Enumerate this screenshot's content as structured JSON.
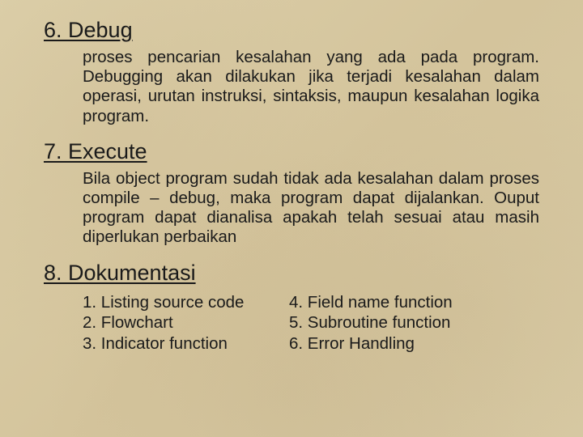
{
  "section6": {
    "heading": "6. Debug",
    "body": "proses pencarian kesalahan yang ada pada program. Debugging akan dilakukan jika terjadi kesalahan dalam operasi, urutan instruksi, sintaksis, maupun kesalahan logika program."
  },
  "section7": {
    "heading": "7. Execute",
    "body": "Bila object program sudah tidak ada kesalahan dalam proses compile – debug, maka program dapat dijalankan. Ouput program dapat dianalisa apakah telah sesuai atau masih diperlukan perbaikan"
  },
  "section8": {
    "heading": "8. Dokumentasi",
    "col1": {
      "i1": "1. Listing source code",
      "i2": "2. Flowchart",
      "i3": "3. Indicator function"
    },
    "col2": {
      "i4": "4. Field name function",
      "i5": "5. Subroutine function",
      "i6": "6. Error Handling"
    }
  }
}
